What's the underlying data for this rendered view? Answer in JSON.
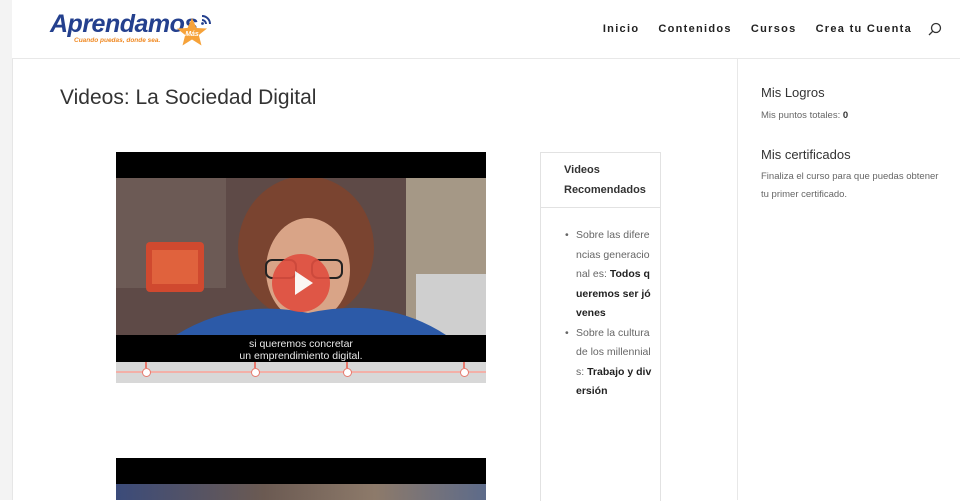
{
  "header": {
    "logo_text": "Aprendamos",
    "logo_badge": "Más",
    "logo_tagline": "Cuando puedas, donde sea.",
    "nav": [
      "Inicio",
      "Contenidos",
      "Cursos",
      "Crea tu Cuenta"
    ],
    "search_icon": "search-icon"
  },
  "main": {
    "title": "Videos: La Sociedad Digital",
    "video": {
      "caption_line1": "si queremos concretar",
      "caption_line2": "un emprendimiento digital.",
      "play_icon": "play-icon",
      "play_color": "#e04e3f"
    }
  },
  "recommended": {
    "title": "Videos Recomendados",
    "items": [
      {
        "prefix": "Sobre las diferencias generacional es: ",
        "bold": "Todos queremos ser jóvenes"
      },
      {
        "prefix": "Sobre la cultura de los millennials: ",
        "bold": "Trabajo y diversión"
      }
    ]
  },
  "sidebar": {
    "logros_title": "Mis Logros",
    "puntos_label": "Mis puntos totales: ",
    "puntos_value": "0",
    "cert_title": "Mis certificados",
    "cert_text": "Finaliza el curso para que puedas obtener tu primer certificado."
  },
  "colors": {
    "brand_blue": "#24408e",
    "brand_orange": "#f08a24",
    "cue_red": "#e77a6e"
  }
}
